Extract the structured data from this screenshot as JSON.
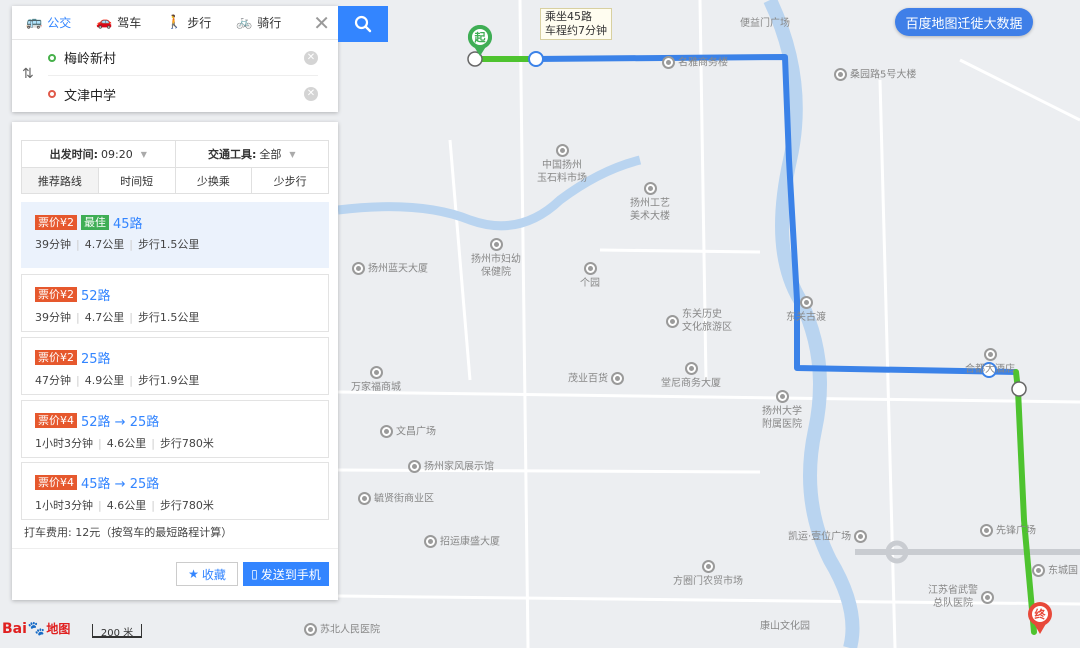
{
  "tabs": [
    {
      "label": "公交",
      "icon": "bus-icon",
      "active": true
    },
    {
      "label": "驾车",
      "icon": "car-icon",
      "active": false
    },
    {
      "label": "步行",
      "icon": "walk-icon",
      "active": false
    },
    {
      "label": "骑行",
      "icon": "bike-icon",
      "active": false
    }
  ],
  "origin": "梅岭新村",
  "destination": "文津中学",
  "filters": {
    "depart_label": "出发时间:",
    "depart_value": "09:20",
    "vehicle_label": "交通工具:",
    "vehicle_value": "全部",
    "sorts": [
      "推荐路线",
      "时间短",
      "少换乘",
      "少步行"
    ]
  },
  "routes": [
    {
      "price": "票价¥2",
      "best": "最佳",
      "name": "45路",
      "duration": "39分钟",
      "distance": "4.7公里",
      "walk": "步行1.5公里"
    },
    {
      "price": "票价¥2",
      "name": "52路",
      "duration": "39分钟",
      "distance": "4.7公里",
      "walk": "步行1.5公里"
    },
    {
      "price": "票价¥2",
      "name": "25路",
      "duration": "47分钟",
      "distance": "4.9公里",
      "walk": "步行1.9公里"
    },
    {
      "price": "票价¥4",
      "name": "52路 → 25路",
      "duration": "1小时3分钟",
      "distance": "4.6公里",
      "walk": "步行780米"
    },
    {
      "price": "票价¥4",
      "name": "45路 → 25路",
      "duration": "1小时3分钟",
      "distance": "4.6公里",
      "walk": "步行780米"
    }
  ],
  "taxi": "打车费用: 12元（按驾车的最短路程计算）",
  "fav_label": "收藏",
  "send_label": "发送到手机",
  "bigdata_label": "百度地图迁徙大数据",
  "bus_callout": {
    "line1": "乘坐45路",
    "line2": "车程约7分钟"
  },
  "start_label": "起",
  "end_label": "终",
  "logo": {
    "bai": "Bai",
    "du": "du",
    "ditu": "地图"
  },
  "scale": "200 米",
  "pois": {
    "bianyi": "便益门广场",
    "mingya": "名雅商务楼",
    "sangyuan": "桑园路5号大楼",
    "zhongguo1": "中国扬州",
    "zhongguo2": "玉石料市场",
    "gongyi1": "扬州工艺",
    "gongyi2": "美术大楼",
    "lantian": "扬州蓝天大厦",
    "fuyou1": "扬州市妇幼",
    "fuyou2": "保健院",
    "geyuan": "个园",
    "dongguan1": "东关历史",
    "dongguan2": "文化旅游区",
    "dongguan_gudu": "东关古渡",
    "hedu": "合都大酒店",
    "wanjiafu": "万家福商城",
    "maoye": "茂业百货",
    "tangni": "堂尼商务大厦",
    "daxue1": "扬州大学",
    "daxue2": "附属医院",
    "wenchang": "文昌广场",
    "jiafeng": "扬州家风展示馆",
    "ganxian": "毓贤街商业区",
    "kaixuan": "凯运·壹位广场",
    "xianfeng": "先锋广场",
    "zhaoyun": "招运康盛大厦",
    "fangquan": "方圈门农贸市场",
    "wujing1": "江苏省武警",
    "wujing2": "总队医院",
    "dongcheng": "东城国",
    "subei": "苏北人民医院",
    "kangshan": "康山文化园"
  }
}
